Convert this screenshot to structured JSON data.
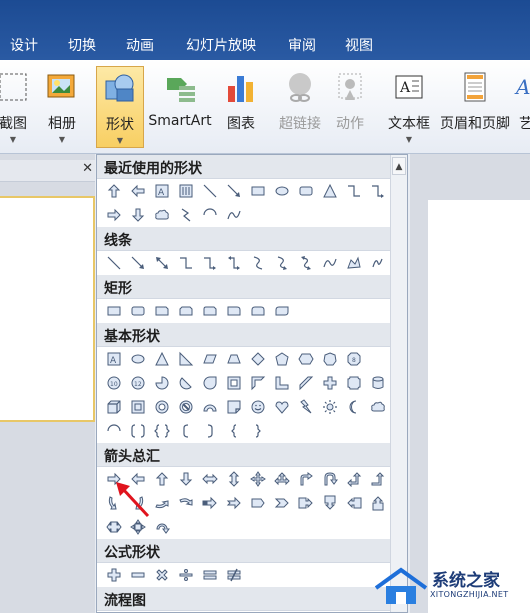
{
  "tabs": [
    "设计",
    "切换",
    "动画",
    "幻灯片放映",
    "审阅",
    "视图"
  ],
  "ribbon": {
    "screenshot_label": "截图",
    "album_label": "相册",
    "shapes_label": "形状",
    "smartart_label": "SmartArt",
    "chart_label": "图表",
    "hyperlink_label": "超链接",
    "action_label": "动作",
    "textbox_label": "文本框",
    "header_footer_label": "页眉和页脚",
    "wordart_label": "艺"
  },
  "dropdown": {
    "sections": [
      {
        "title": "最近使用的形状",
        "rows": [
          [
            "arrow-up",
            "arrow-left",
            "textbox",
            "textbox-v",
            "line",
            "line-arrow",
            "rect",
            "oval",
            "rounded-rect",
            "triangle",
            "elbow",
            "elbow-arrow"
          ],
          [
            "arrow-right",
            "arrow-down",
            "cloud",
            "zigzag",
            "arc",
            "curve"
          ]
        ]
      },
      {
        "title": "线条",
        "rows": [
          [
            "line",
            "line-arrow",
            "line-double-arrow",
            "elbow",
            "elbow-arrow",
            "elbow-double",
            "curve-s",
            "curve-s-arrow",
            "curve-s-double",
            "curve",
            "freeform",
            "scribble"
          ]
        ]
      },
      {
        "title": "矩形",
        "rows": [
          [
            "rect",
            "rounded-rect",
            "snip-rect",
            "snip2",
            "snip-round",
            "round1",
            "round2",
            "round-diag"
          ]
        ]
      },
      {
        "title": "基本形状",
        "rows": [
          [
            "textbox",
            "oval",
            "triangle",
            "rtriangle",
            "parallelogram",
            "trapezoid",
            "diamond",
            "pentagon",
            "hexagon",
            "heptagon",
            "octagon"
          ],
          [
            "decagon",
            "dodecagon",
            "pie",
            "chord",
            "teardrop",
            "frame",
            "half-frame",
            "l-shape",
            "diagonal-stripe",
            "cross",
            "plaque",
            "can"
          ],
          [
            "cube",
            "bevel",
            "donut",
            "no-symbol",
            "block-arc",
            "folded-corner",
            "smiley",
            "heart",
            "lightning",
            "sun",
            "moon",
            "cloud"
          ],
          [
            "arc",
            "bracket-pair",
            "brace-pair",
            "left-bracket",
            "right-bracket",
            "left-brace",
            "right-brace"
          ]
        ]
      },
      {
        "title": "箭头总汇",
        "rows": [
          [
            "arrow-right",
            "arrow-left",
            "arrow-up",
            "arrow-down",
            "arrow-lr",
            "arrow-ud",
            "arrow-quad",
            "arrow-lru",
            "arrow-bent",
            "arrow-uturn",
            "arrow-lu",
            "arrow-bentup"
          ],
          [
            "arrow-curved-r",
            "arrow-curved-l",
            "arrow-curved-u",
            "arrow-curved-d",
            "arrow-striped",
            "arrow-notched",
            "pentagon-arrow",
            "chevron",
            "callout-right",
            "callout-down",
            "callout-left",
            "callout-up"
          ],
          [
            "callout-lr",
            "callout-quad",
            "circular-arrow"
          ]
        ]
      },
      {
        "title": "公式形状",
        "rows": [
          [
            "plus",
            "minus",
            "multiply",
            "divide",
            "equal",
            "not-equal"
          ]
        ]
      },
      {
        "title": "流程图",
        "rows": []
      }
    ]
  },
  "watermark": {
    "title": "系统之家",
    "subtitle": "XITONGZHIJIA.NET"
  }
}
